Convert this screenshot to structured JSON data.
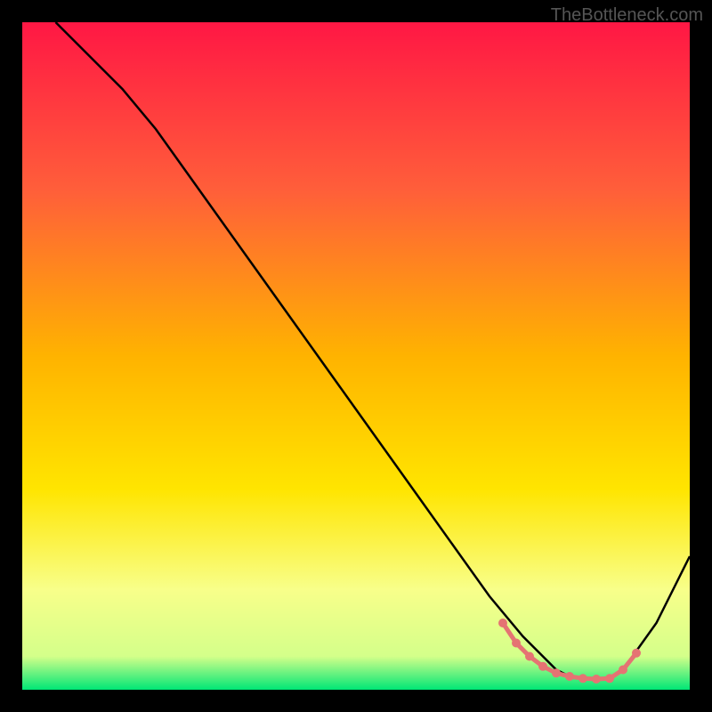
{
  "watermark": "TheBottleneck.com",
  "chart_data": {
    "type": "line",
    "title": "",
    "xlabel": "",
    "ylabel": "",
    "xlim": [
      0,
      100
    ],
    "ylim": [
      0,
      100
    ],
    "gradient_stops": [
      {
        "offset": 0,
        "color": "#ff1744"
      },
      {
        "offset": 25,
        "color": "#ff5e3a"
      },
      {
        "offset": 50,
        "color": "#ffb300"
      },
      {
        "offset": 70,
        "color": "#ffe500"
      },
      {
        "offset": 85,
        "color": "#f8ff8a"
      },
      {
        "offset": 95,
        "color": "#d4ff8a"
      },
      {
        "offset": 100,
        "color": "#00e676"
      }
    ],
    "series": [
      {
        "name": "bottleneck-curve",
        "color": "#000000",
        "x": [
          5,
          10,
          15,
          20,
          25,
          30,
          35,
          40,
          45,
          50,
          55,
          60,
          65,
          70,
          75,
          80,
          82,
          85,
          88,
          90,
          95,
          100
        ],
        "y": [
          100,
          95,
          90,
          84,
          77,
          70,
          63,
          56,
          49,
          42,
          35,
          28,
          21,
          14,
          8,
          3,
          2,
          1.5,
          1.5,
          3,
          10,
          20
        ]
      }
    ],
    "marker_segment": {
      "color": "#e57373",
      "points": [
        {
          "x": 72,
          "y": 10
        },
        {
          "x": 74,
          "y": 7
        },
        {
          "x": 76,
          "y": 5
        },
        {
          "x": 78,
          "y": 3.5
        },
        {
          "x": 80,
          "y": 2.5
        },
        {
          "x": 82,
          "y": 2
        },
        {
          "x": 84,
          "y": 1.7
        },
        {
          "x": 86,
          "y": 1.6
        },
        {
          "x": 88,
          "y": 1.7
        },
        {
          "x": 90,
          "y": 3
        },
        {
          "x": 92,
          "y": 5.5
        }
      ]
    }
  }
}
